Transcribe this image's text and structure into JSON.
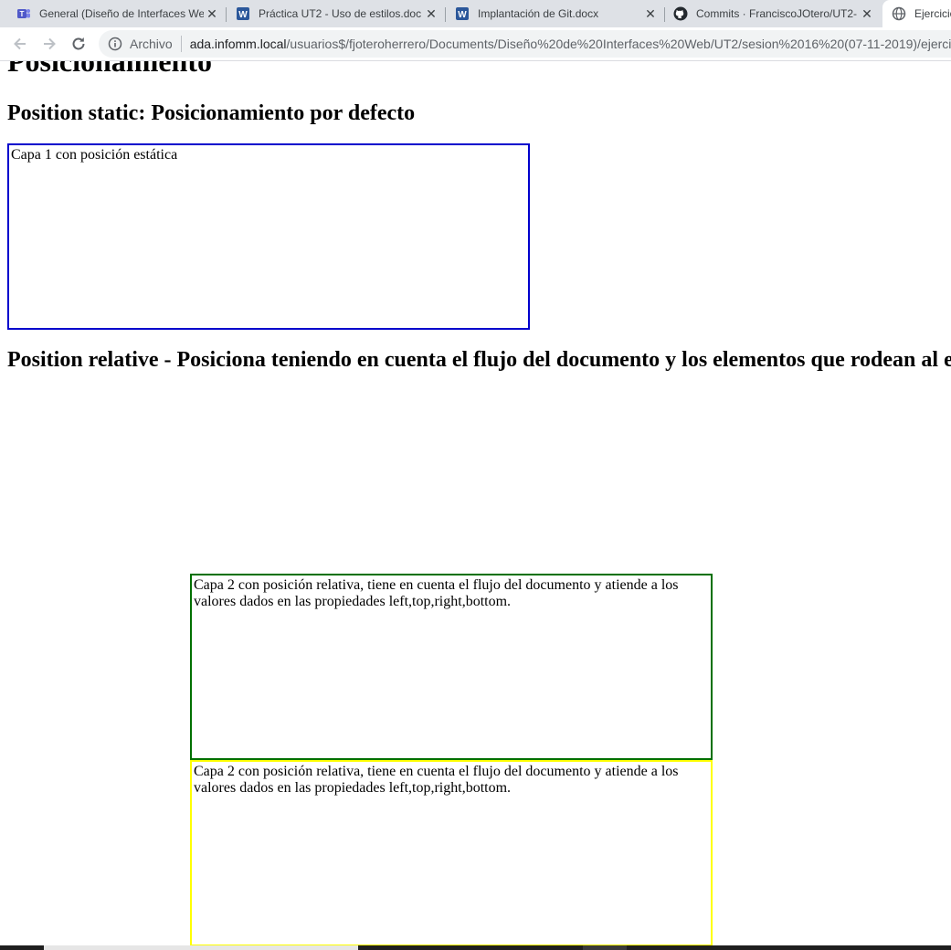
{
  "browser": {
    "tabs": [
      {
        "title": "General (Diseño de Interfaces We",
        "icon": "teams-icon"
      },
      {
        "title": "Práctica UT2 - Uso de estilos.doc",
        "icon": "word-icon"
      },
      {
        "title": "Implantación de Git.docx",
        "icon": "word-icon"
      },
      {
        "title": "Commits · FranciscoJOtero/UT2-",
        "icon": "github-icon"
      },
      {
        "title": "Ejercicio",
        "icon": "globe-icon"
      }
    ],
    "tab_close_glyph": "✕",
    "address": {
      "security_label": "Archivo",
      "host": "ada.infomm.local",
      "path": "/usuarios$/fjoteroherrero/Documents/Diseño%20de%20Interfaces%20Web/UT2/sesion%2016%20(07-11-2019)/ejercicio"
    }
  },
  "page": {
    "title": "Posicionamiento",
    "section_static": "Position static: Posicionamiento por defecto",
    "capa1_text": "Capa 1 con posición estática",
    "section_relative": "Position relative - Posiciona teniendo en cuenta el flujo del documento y los elementos que rodean al e",
    "capa2_text": "Capa 2 con posición relativa, tiene en cuenta el flujo del documento y atiende a los valores dados en las propiedades left,top,right,bottom.",
    "capa3_text": "Capa 2 con posición relativa, tiene en cuenta el flujo del documento y atiende a los valores dados en las propiedades left,top,right,bottom."
  },
  "colors": {
    "capa1_border": "#0000cc",
    "capa2_border": "#007000",
    "capa3_border": "#ffff00",
    "teams": "#5059c9",
    "word": "#2b579a"
  }
}
